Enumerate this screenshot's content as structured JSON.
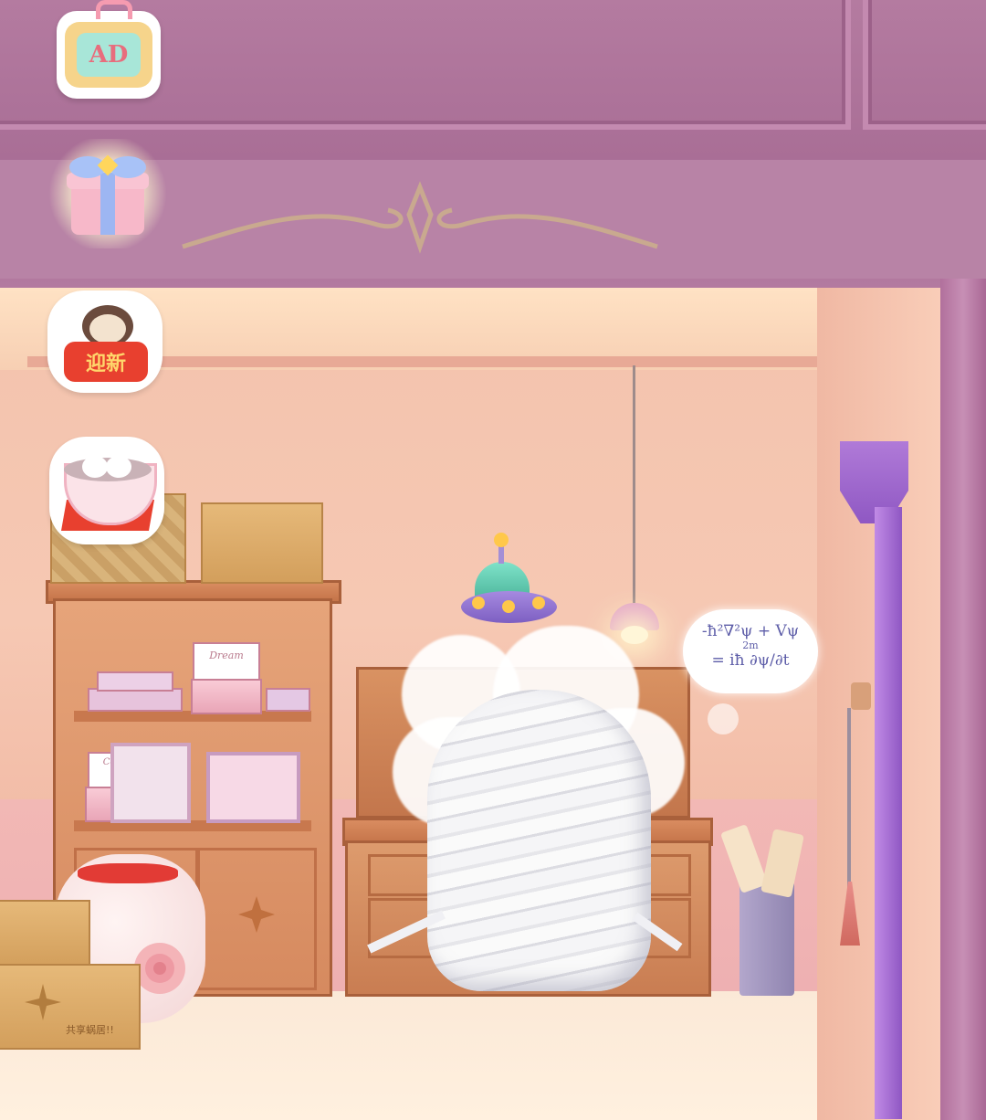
{
  "hud": {
    "ad_button": {
      "label": "AD",
      "icon": "tv-ad-icon"
    },
    "gift_button": {
      "icon": "gift-box-icon"
    },
    "event_banner": {
      "label": "迎新",
      "icon": "cat-new-year-icon"
    },
    "bowl_button": {
      "icon": "rice-ball-bowl-icon"
    }
  },
  "scene": {
    "thought_bubble": {
      "line1": "-ħ²∇²ψ + Vψ",
      "line2": "2m",
      "line3": "= iħ ∂ψ/∂t"
    },
    "shelf_box_label": "Dream",
    "shelf_box_sub": "Coffee",
    "crate_text": "共享蜗居!!",
    "character": "mummy-character",
    "hat": "ufo-hat"
  },
  "colors": {
    "facade": "#a86d95",
    "wall": "#f4c3ae",
    "floor": "#fbe9d7",
    "pillar_purple": "#9a5fc9"
  }
}
